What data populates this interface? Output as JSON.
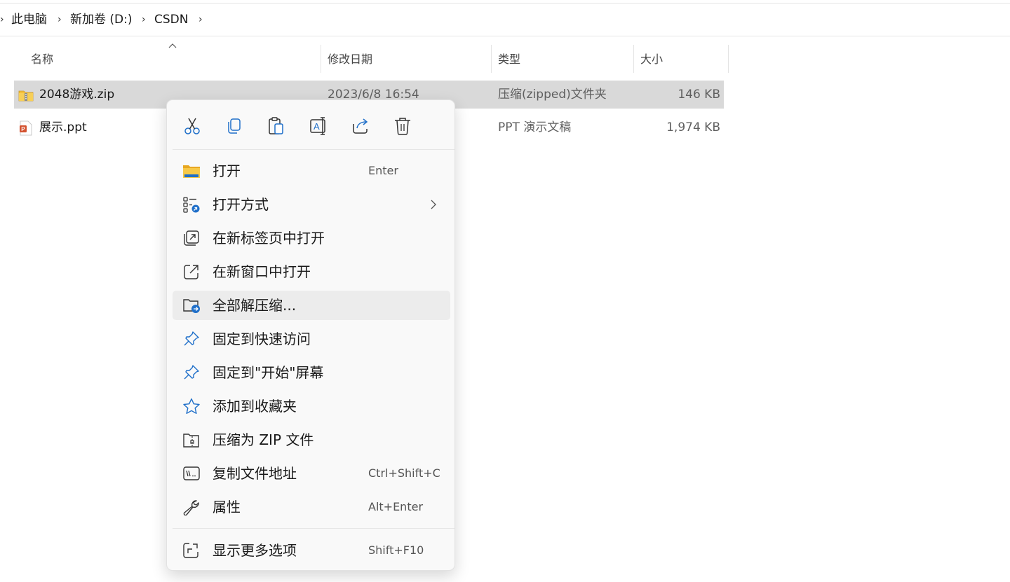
{
  "breadcrumb": {
    "items": [
      "此电脑",
      "新加卷 (D:)",
      "CSDN"
    ]
  },
  "columns": {
    "name": "名称",
    "date": "修改日期",
    "type": "类型",
    "size": "大小"
  },
  "files": [
    {
      "name": "2048游戏.zip",
      "date": "2023/6/8 16:54",
      "type": "压缩(zipped)文件夹",
      "size": "146 KB",
      "icon": "zip-folder-icon",
      "selected": true
    },
    {
      "name": "展示.ppt",
      "date": "",
      "type": "PPT 演示文稿",
      "size": "1,974 KB",
      "icon": "ppt-file-icon",
      "selected": false
    }
  ],
  "context_menu": {
    "quick_actions": [
      "cut-icon",
      "copy-icon",
      "paste-icon",
      "rename-icon",
      "share-icon",
      "delete-icon"
    ],
    "items": [
      {
        "label": "打开",
        "shortcut": "Enter",
        "icon": "folder-icon"
      },
      {
        "label": "打开方式",
        "shortcut": "",
        "icon": "open-with-icon",
        "has_submenu": true
      },
      {
        "label": "在新标签页中打开",
        "shortcut": "",
        "icon": "new-tab-icon"
      },
      {
        "label": "在新窗口中打开",
        "shortcut": "",
        "icon": "new-window-icon"
      },
      {
        "label": "全部解压缩...",
        "shortcut": "",
        "icon": "extract-icon",
        "highlighted": true
      },
      {
        "label": "固定到快速访问",
        "shortcut": "",
        "icon": "pin-icon"
      },
      {
        "label": "固定到\"开始\"屏幕",
        "shortcut": "",
        "icon": "pin-start-icon"
      },
      {
        "label": "添加到收藏夹",
        "shortcut": "",
        "icon": "star-icon"
      },
      {
        "label": "压缩为 ZIP 文件",
        "shortcut": "",
        "icon": "zip-icon"
      },
      {
        "label": "复制文件地址",
        "shortcut": "Ctrl+Shift+C",
        "icon": "copy-path-icon"
      },
      {
        "label": "属性",
        "shortcut": "Alt+Enter",
        "icon": "wrench-icon"
      },
      {
        "label": "显示更多选项",
        "shortcut": "Shift+F10",
        "icon": "more-options-icon"
      }
    ]
  },
  "colors": {
    "selection": "#d9d9d9",
    "menu_bg": "#f9f9f9",
    "accent_blue": "#1f6fc9",
    "folder_yellow": "#f4c13b",
    "ppt_orange": "#d35230"
  }
}
